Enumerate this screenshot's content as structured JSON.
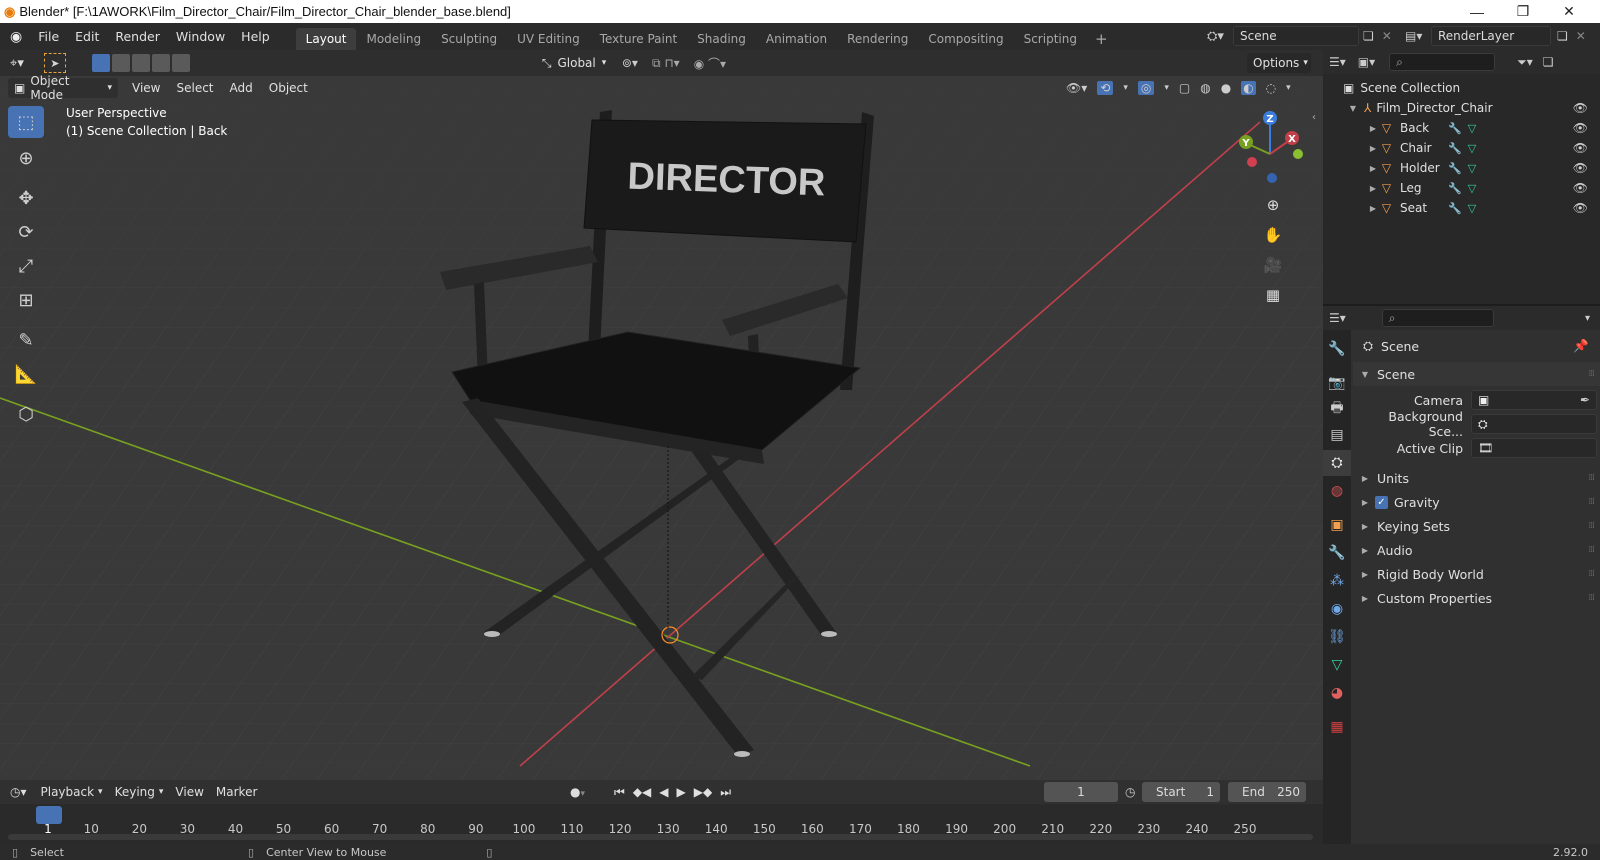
{
  "window": {
    "title": "Blender* [F:\\1AWORK\\Film_Director_Chair/Film_Director_Chair_blender_base.blend]",
    "minimize_icon": "minimize-icon",
    "maximize_icon": "restore-icon",
    "close_icon": "close-icon"
  },
  "menu": {
    "items": [
      "File",
      "Edit",
      "Render",
      "Window",
      "Help"
    ]
  },
  "workspaces": {
    "active": "Layout",
    "tabs": [
      "Layout",
      "Modeling",
      "Sculpting",
      "UV Editing",
      "Texture Paint",
      "Shading",
      "Animation",
      "Rendering",
      "Compositing",
      "Scripting"
    ],
    "add_label": "+"
  },
  "scene_selector": {
    "value": "Scene"
  },
  "render_layer": {
    "value": "RenderLayer"
  },
  "viewport": {
    "mode": "Object Mode",
    "menus": [
      "View",
      "Select",
      "Add",
      "Object"
    ],
    "orientation": "Global",
    "options_label": "Options",
    "perspective_label": "User Perspective",
    "collection_label": "(1) Scene Collection | Back",
    "chair_text": "DIRECTOR",
    "gizmo": {
      "x": "X",
      "y": "Y",
      "z": "Z"
    }
  },
  "outliner": {
    "root": "Scene Collection",
    "collection": "Film_Director_Chair",
    "objects": [
      "Back",
      "Chair",
      "Holder",
      "Leg",
      "Seat"
    ]
  },
  "properties": {
    "header": "Scene",
    "panel_title": "Scene",
    "camera_label": "Camera",
    "background_label": "Background Sce...",
    "active_clip_label": "Active Clip",
    "sections": [
      "Units",
      "Gravity",
      "Keying Sets",
      "Audio",
      "Rigid Body World",
      "Custom Properties"
    ],
    "gravity_checked": true
  },
  "timeline": {
    "menus": [
      "Playback",
      "Keying",
      "View",
      "Marker"
    ],
    "current_frame": "1",
    "start_label": "Start",
    "start_value": "1",
    "end_label": "End",
    "end_value": "250",
    "ruler": [
      "1",
      "10",
      "20",
      "30",
      "40",
      "50",
      "60",
      "70",
      "80",
      "90",
      "100",
      "110",
      "120",
      "130",
      "140",
      "150",
      "160",
      "170",
      "180",
      "190",
      "200",
      "210",
      "220",
      "230",
      "240",
      "250"
    ]
  },
  "status": {
    "select": "Select",
    "center_view": "Center View to Mouse",
    "version": "2.92.0"
  },
  "colors": {
    "accent": "#4772b3",
    "x_axis": "#c0404a",
    "y_axis": "#78a020",
    "z_axis": "#3b7ddd"
  }
}
